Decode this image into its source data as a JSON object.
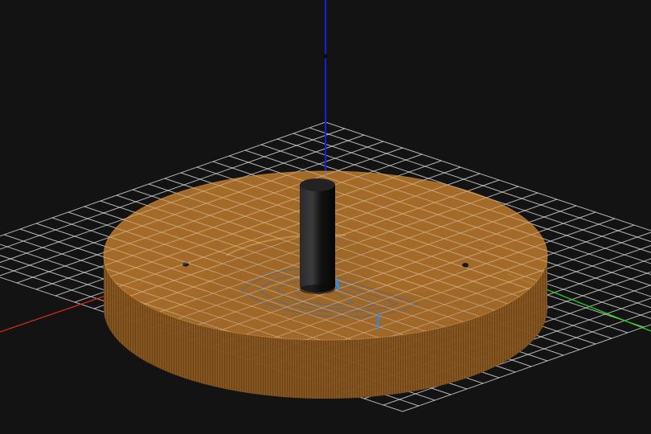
{
  "viewer": {
    "background_color": "#131313",
    "grid_color": "#e8e8e8",
    "axis_colors": {
      "x": "#d62a1c",
      "y": "#1fd31f",
      "z": "#1c1ce0"
    }
  },
  "stock": {
    "color": "#b5752b",
    "wall_color": "#9c6326",
    "shape": "cylinder-disc"
  },
  "tool": {
    "color": "#141414",
    "shape": "cylindrical-end-mill"
  },
  "toolpath": {
    "color": "#5e6877",
    "current_move_color": "#1e8fff"
  }
}
